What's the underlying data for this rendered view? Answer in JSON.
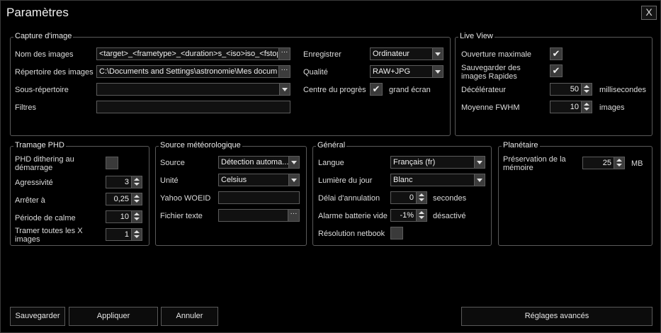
{
  "window": {
    "title": "Paramètres",
    "close_label": "X"
  },
  "capture": {
    "title": "Capture d'image",
    "name_label": "Nom des images",
    "name_value": "<target>_<frametype>_<duration>s_<iso>iso_<fstop>",
    "dir_label": "Répertoire des images",
    "dir_value": "C:\\Documents and Settings\\astronomie\\Mes docum",
    "subdir_label": "Sous-répertoire",
    "subdir_value": "",
    "filters_label": "Filtres",
    "filters_value": "",
    "save_label": "Enregistrer",
    "save_value": "Ordinateur",
    "quality_label": "Qualité",
    "quality_value": "RAW+JPG",
    "center_label": "Centre du progrès",
    "center_suffix": "grand écran",
    "center_checked": true,
    "ellipsis": "···"
  },
  "liveview": {
    "title": "Live View",
    "max_aperture_label": "Ouverture maximale",
    "max_aperture_checked": true,
    "save_rapid_label": "Sauvegarder des images Rapides",
    "save_rapid_checked": true,
    "decel_label": "Décélérateur",
    "decel_value": "50",
    "decel_unit": "millisecondes",
    "fwhm_label": "Moyenne FWHM",
    "fwhm_value": "10",
    "fwhm_unit": "images"
  },
  "phd": {
    "title": "Tramage PHD",
    "dither_label": "PHD dithering au démarrage",
    "dither_checked": false,
    "aggr_label": "Agressivité",
    "aggr_value": "3",
    "stop_label": "Arrêter à",
    "stop_value": "0,25",
    "calm_label": "Période de calme",
    "calm_value": "10",
    "every_label": "Tramer toutes les X images",
    "every_value": "1"
  },
  "weather": {
    "title": "Source météorologique",
    "source_label": "Source",
    "source_value": "Détection automa...",
    "unit_label": "Unité",
    "unit_value": "Celsius",
    "woeid_label": "Yahoo WOEID",
    "woeid_value": "",
    "file_label": "Fichier texte",
    "file_value": "",
    "ellipsis": "···"
  },
  "general": {
    "title": "Général",
    "lang_label": "Langue",
    "lang_value": "Français (fr)",
    "daylight_label": "Lumière du jour",
    "daylight_value": "Blanc",
    "cancel_delay_label": "Délai d'annulation",
    "cancel_delay_value": "0",
    "cancel_delay_unit": "secondes",
    "battery_label": "Alarme batterie vide",
    "battery_value": "-1%",
    "battery_unit": "désactivé",
    "netbook_label": "Résolution netbook",
    "netbook_checked": false
  },
  "planetary": {
    "title": "Planétaire",
    "mem_label": "Préservation de la mémoire",
    "mem_value": "25",
    "mem_unit": "MB"
  },
  "footer": {
    "save": "Sauvegarder",
    "apply": "Appliquer",
    "cancel": "Annuler",
    "advanced": "Réglages avancés"
  },
  "check_mark": "✔"
}
